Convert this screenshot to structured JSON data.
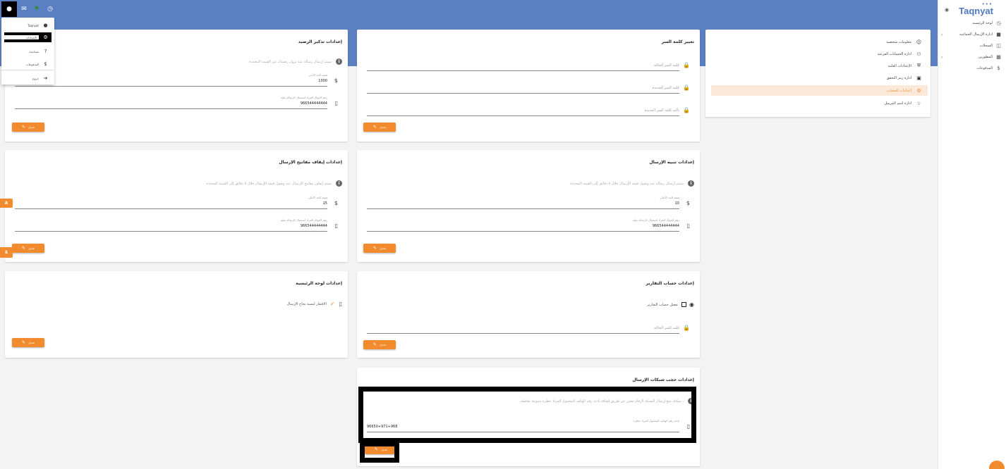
{
  "brand": {
    "name": "Taqnyat",
    "dots": "•••"
  },
  "topbar": {
    "icons": [
      "account-icon",
      "email-icon",
      "flag-icon",
      "clock-icon"
    ]
  },
  "account_menu": {
    "items": [
      {
        "label": "Taqnyat",
        "icon": "user-circle-icon"
      },
      {
        "label": "الإعدادات",
        "icon": "gear-icon"
      },
      {
        "label": "مساعدة",
        "icon": "help-icon"
      },
      {
        "label": "المدفوعات",
        "icon": "dollar-icon"
      },
      {
        "label": "خروج",
        "icon": "logout-icon"
      }
    ]
  },
  "sidebar": {
    "items": [
      {
        "label": "لوحة الرئيسية"
      },
      {
        "label": "ادارة الإرسال الجماعية"
      },
      {
        "label": "السجلات"
      },
      {
        "label": "المطورين"
      },
      {
        "label": "المدفوعات"
      }
    ]
  },
  "settings_nav": {
    "items": [
      {
        "label": "معلومات شخصية"
      },
      {
        "label": "ادارة الحسابات الفرعية"
      },
      {
        "label": "الإعدادات العامة"
      },
      {
        "label": "ادارة رمز التحقق"
      },
      {
        "label": "إعدادات الحساب"
      },
      {
        "label": "ادارة اسم المرسل"
      }
    ]
  },
  "change_password": {
    "title": "تغيير كلمة السر",
    "fields": [
      "كلمة السر الحالية",
      "كلمة السر الجديدة",
      "تأكيد كلمة السر الجديدة"
    ],
    "button": "تعديل"
  },
  "balance_reminder": {
    "title": "إعدادات تذكير الرصيد",
    "info": "سيتم إرسال رسالة عند نزول رصيدك عن القيمة المحددة",
    "value_label": "قيمة الحد الأدنى",
    "value": "1000",
    "phone_label": "رقم الجوال المراد استقبال الرسالة عليه",
    "phone": "966544444444",
    "button": "تعديل"
  },
  "sending_alert": {
    "title": "إعدادات تنبيه الإرسال",
    "info": "سيتم إرسال رسالة عند وصول قيمة الإرسال خلال ٥ دقائق إلى القيمة المحددة",
    "value_label": "قيمة الحد الأعلى",
    "value": "10",
    "phone_label": "رقم الجوال المراد استقبال الرسالة عليه",
    "phone": "966544444444",
    "button": "تعديل"
  },
  "stop_keys": {
    "title": "إعدادات إيقاف مفاتيح الإرسال",
    "info": "سيتم إيقاف مفاتيح الإرسال عند وصول قيمة الإرسال خلال ٥ دقائق إلى القيمة المحددة",
    "value_label": "قيمة الحد الأعلى",
    "value": "15",
    "phone_label": "رقم الجوال المراد استقبال الرسالة عليه",
    "phone": "966544444444",
    "button": "تعديل"
  },
  "reports_account": {
    "title": "إعدادات حساب التقارير",
    "checkbox_label": "تفعيل حساب التقارير",
    "password_label": "كلمة السر الحالية",
    "button": "تعديل"
  },
  "dashboard_settings": {
    "title": "إعدادات لوحة الرئيسية",
    "option_label": "الافتقار لنسبة نجاح الإرسال",
    "button": "تعديل"
  },
  "network_block": {
    "title": "إعدادات حجب شبكات الإرسال",
    "info": "يمكنك منع إرسال الشبكة لأرقام معين عن طريق إضافة بادئة رقم الهاتف المحمول المراد حظره متبوعة بفاصلة ،",
    "field_label": "بادئة رقم الهاتف المحمول المراد حظره",
    "value": "96650+971+968",
    "button": "تعديل"
  },
  "side_tabs": [
    "A",
    "$"
  ]
}
